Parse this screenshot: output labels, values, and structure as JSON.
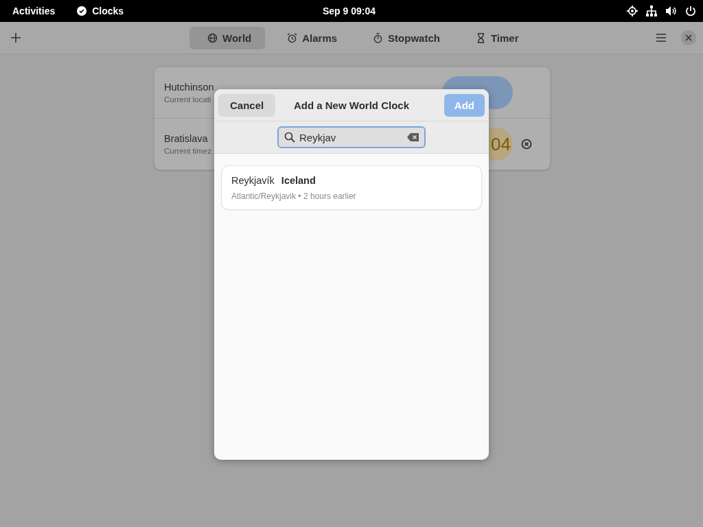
{
  "top_bar": {
    "activities": "Activities",
    "app_name": "Clocks",
    "datetime": "Sep 9  09:04"
  },
  "header": {
    "tabs": [
      {
        "label": "World",
        "kind": "globe",
        "selected": true
      },
      {
        "label": "Alarms",
        "kind": "alarm",
        "selected": false
      },
      {
        "label": "Stopwatch",
        "kind": "stopwatch",
        "selected": false
      },
      {
        "label": "Timer",
        "kind": "timer",
        "selected": false
      }
    ]
  },
  "clocks": [
    {
      "city": "Hutchinson",
      "subtitle": "Current locati",
      "kind": "night",
      "removable": false
    },
    {
      "city": "Bratislava",
      "subtitle": "Current timez",
      "time": "04",
      "kind": "day",
      "removable": true
    }
  ],
  "dialog": {
    "cancel": "Cancel",
    "title": "Add a New World Clock",
    "add": "Add",
    "add_disabled": true,
    "search": {
      "value": "Reykjav"
    },
    "results": [
      {
        "city": "Reykjavík",
        "country": "Iceland",
        "detail": "Atlantic/Reykjavik • 2 hours earlier"
      }
    ]
  }
}
